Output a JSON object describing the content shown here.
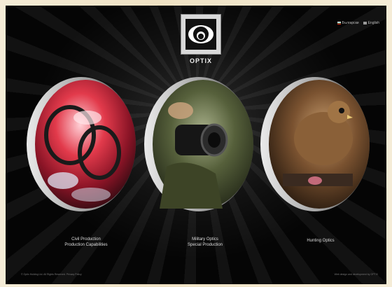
{
  "language": {
    "bg_label": "Български",
    "en_label": "English"
  },
  "logo": {
    "text": "OPTIX"
  },
  "sections": [
    {
      "line1": "Civil Production",
      "line2": "Production Capabilities"
    },
    {
      "line1": "Military Optics",
      "line2": "Special Production"
    },
    {
      "line1": "Hunting Optics",
      "line2": ""
    }
  ],
  "footer": {
    "left": "© Optix Holding Ltd. All Rights Reserved. Privacy Policy",
    "right": "Web design and development by OPTIX"
  },
  "colors": {
    "background": "#050505",
    "outer_background": "#f4ecd8",
    "lens_rim": "#d7d7d7"
  }
}
